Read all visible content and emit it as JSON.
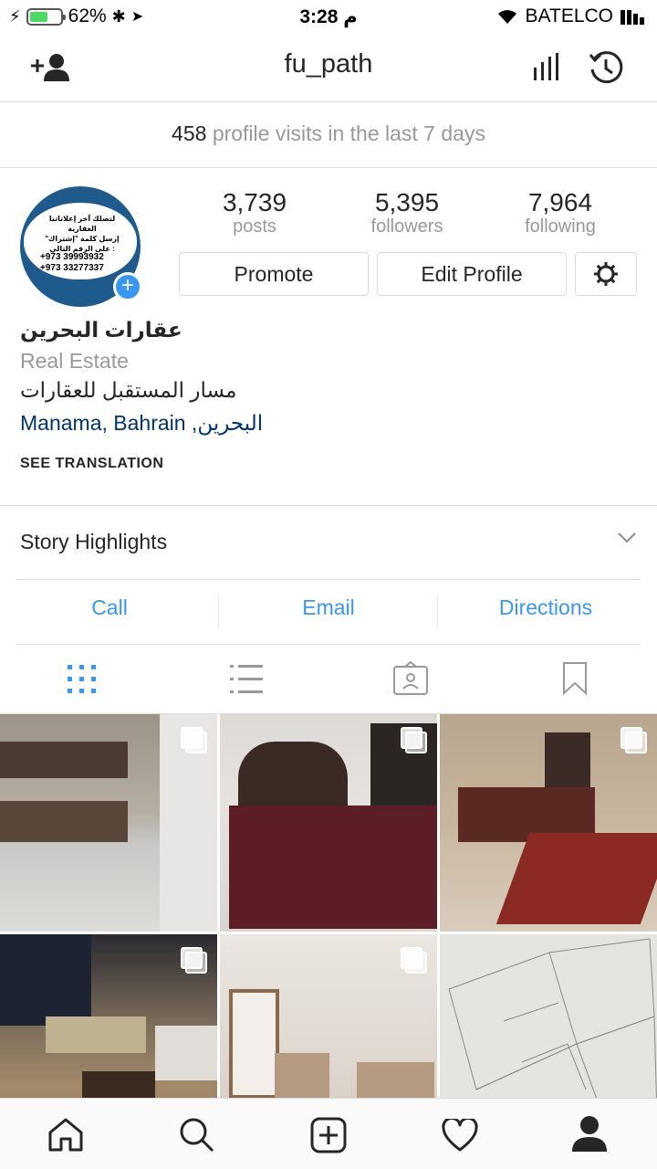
{
  "status": {
    "battery": "62%",
    "time": "3:28 م",
    "carrier": "BATELCO"
  },
  "nav": {
    "username": "fu_path"
  },
  "visits": {
    "count": "458",
    "text": "profile visits in the last 7 days"
  },
  "avatar": {
    "line1": "لتصلك آخر إعلاناتنا العقارية",
    "line2": "إرسل كلمة \"إشتراك\" على الرقم التالي :",
    "phone1": "+973 39993932",
    "phone2": "+973 33277337"
  },
  "stats": [
    {
      "value": "3,739",
      "label": "posts"
    },
    {
      "value": "5,395",
      "label": "followers"
    },
    {
      "value": "7,964",
      "label": "following"
    }
  ],
  "buttons": {
    "promote": "Promote",
    "edit_profile": "Edit Profile"
  },
  "bio": {
    "name": "عقارات البحرين",
    "category": "Real Estate",
    "description": "مسار المستقبل للعقارات",
    "location": "Manama, Bahrain ,البحرين",
    "translation": "SEE TRANSLATION"
  },
  "highlights": {
    "title": "Story Highlights"
  },
  "contact": {
    "call": "Call",
    "email": "Email",
    "directions": "Directions"
  },
  "colors": {
    "link": "#3897f0",
    "muted": "#999999",
    "divider": "#dbdbdb",
    "location": "#003569"
  }
}
